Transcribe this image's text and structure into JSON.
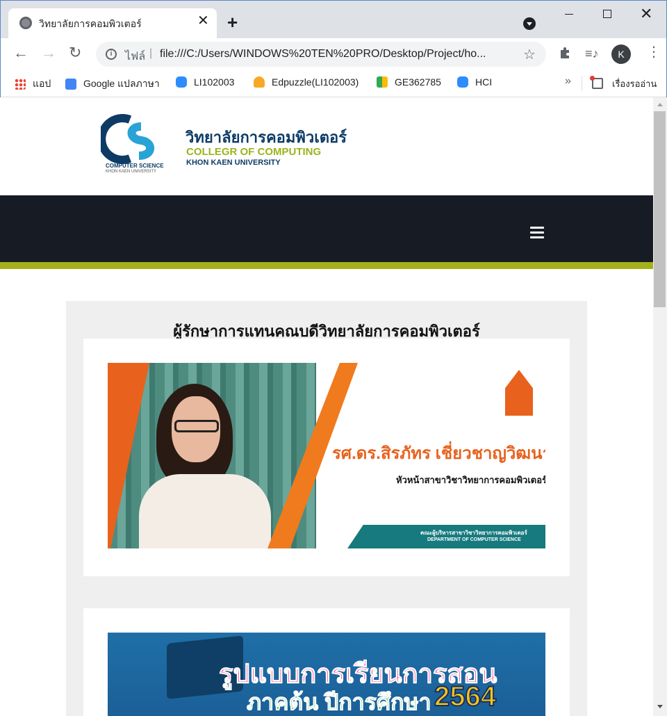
{
  "browser": {
    "tab_title": "วิทยาลัยการคอมพิวเตอร์",
    "url_prefix": "ไฟล์",
    "url": "file:///C:/Users/WINDOWS%20TEN%20PRO/Desktop/Project/ho...",
    "avatar_initial": "K",
    "bookmarks": [
      {
        "label": "แอป",
        "icon": "apps-icon"
      },
      {
        "label": "Google แปลภาษา",
        "icon": "google-translate-icon"
      },
      {
        "label": "LI102003",
        "icon": "zoom-icon"
      },
      {
        "label": "Edpuzzle(LI102003)",
        "icon": "edpuzzle-icon"
      },
      {
        "label": "GE362785",
        "icon": "meet-icon"
      },
      {
        "label": "HCI",
        "icon": "zoom-icon"
      }
    ],
    "reading_list": "เรื่องรออ่าน"
  },
  "site": {
    "logo_sub1": "COMPUTER SCIENCE",
    "logo_sub2": "KHON KAEN UNIVERSITY",
    "college_th": "วิทยาลัยการคอมพิวเตอร์",
    "college_en": "COLLEGR OF COMPUTING",
    "college_uni": "KHON KAEN UNIVERSITY",
    "colors": {
      "navbar": "#171c24",
      "accent": "#a3b01b",
      "brand_blue": "#0d3b66"
    }
  },
  "content": {
    "panel_title": "ผู้รักษาการแทนคณบดีวิทยาลัยการคอมพิวเตอร์",
    "banner1": {
      "name": "รศ.ดร.สิรภัทร เชี่ยวชาญวิฒนา",
      "role": "หัวหน้าสาขาวิชาวิทยาการคอมพิวเตอร์",
      "dept_th": "คณะผู้บริหารสาขาวิชาวิทยาการคอมพิวเตอร์",
      "dept_en": "DEPARTMENT OF COMPUTER SCIENCE"
    },
    "banner2": {
      "line1": "รูปแบบการเรียนการสอน",
      "line2": "ภาคต้น ปีการศึกษา",
      "year": "2564"
    }
  }
}
